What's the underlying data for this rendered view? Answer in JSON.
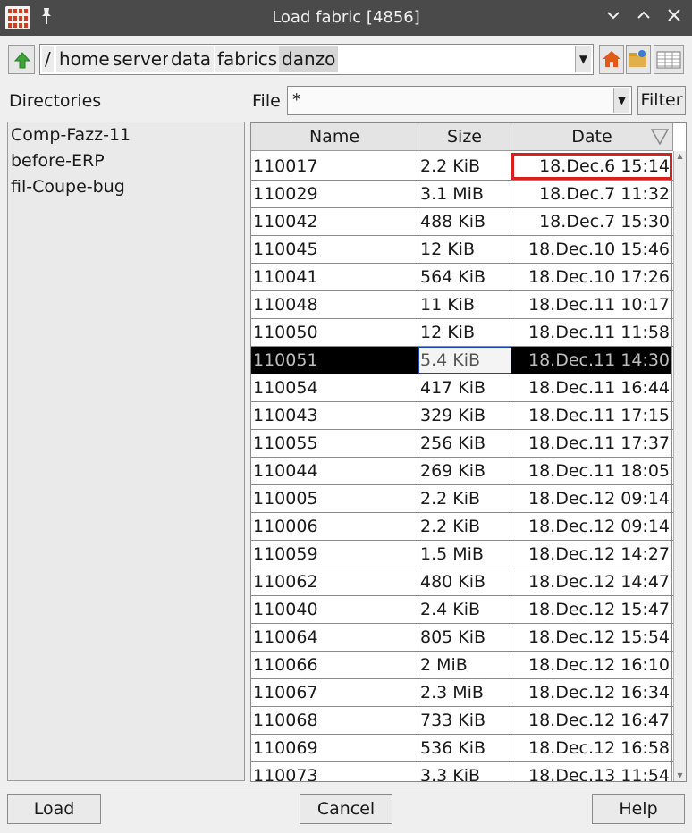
{
  "window": {
    "title": "Load fabric [4856]",
    "icons": [
      "app-icon",
      "pin-icon",
      "minimize-icon",
      "maximize-icon",
      "close-icon"
    ]
  },
  "path": {
    "root": "/",
    "segments": [
      "home",
      "server",
      "data",
      "fabrics",
      "danzo"
    ],
    "toolbar_icons": [
      "up-arrow-icon",
      "home-icon",
      "new-folder-icon",
      "detail-view-icon"
    ]
  },
  "directories": {
    "label": "Directories",
    "items": [
      "Comp-Fazz-11",
      "before-ERP",
      "fil-Coupe-bug"
    ]
  },
  "filter": {
    "label": "File",
    "value": "*",
    "button_label": "Filter"
  },
  "table": {
    "columns": [
      "Name",
      "Size",
      "Date"
    ],
    "sort_column": "Date",
    "sort_icon": "sort-desc-icon",
    "rows": [
      {
        "name": "110017",
        "size": "2.2 KiB",
        "date": "18.Dec.6 15:14"
      },
      {
        "name": "110029",
        "size": "3.1 MiB",
        "date": "18.Dec.7 11:32"
      },
      {
        "name": "110042",
        "size": "488 KiB",
        "date": "18.Dec.7 15:30"
      },
      {
        "name": "110045",
        "size": "12 KiB",
        "date": "18.Dec.10 15:46"
      },
      {
        "name": "110041",
        "size": "564 KiB",
        "date": "18.Dec.10 17:26"
      },
      {
        "name": "110048",
        "size": "11 KiB",
        "date": "18.Dec.11 10:17"
      },
      {
        "name": "110050",
        "size": "12 KiB",
        "date": "18.Dec.11 11:58"
      },
      {
        "name": "110051",
        "size": "5.4 KiB",
        "date": "18.Dec.11 14:30"
      },
      {
        "name": "110054",
        "size": "417 KiB",
        "date": "18.Dec.11 16:44"
      },
      {
        "name": "110043",
        "size": "329 KiB",
        "date": "18.Dec.11 17:15"
      },
      {
        "name": "110055",
        "size": "256 KiB",
        "date": "18.Dec.11 17:37"
      },
      {
        "name": "110044",
        "size": "269 KiB",
        "date": "18.Dec.11 18:05"
      },
      {
        "name": "110005",
        "size": "2.2 KiB",
        "date": "18.Dec.12 09:14"
      },
      {
        "name": "110006",
        "size": "2.2 KiB",
        "date": "18.Dec.12 09:14"
      },
      {
        "name": "110059",
        "size": "1.5 MiB",
        "date": "18.Dec.12 14:27"
      },
      {
        "name": "110062",
        "size": "480 KiB",
        "date": "18.Dec.12 14:47"
      },
      {
        "name": "110040",
        "size": "2.4 KiB",
        "date": "18.Dec.12 15:47"
      },
      {
        "name": "110064",
        "size": "805 KiB",
        "date": "18.Dec.12 15:54"
      },
      {
        "name": "110066",
        "size": "2 MiB",
        "date": "18.Dec.12 16:10"
      },
      {
        "name": "110067",
        "size": "2.3 MiB",
        "date": "18.Dec.12 16:34"
      },
      {
        "name": "110068",
        "size": "733 KiB",
        "date": "18.Dec.12 16:47"
      },
      {
        "name": "110069",
        "size": "536 KiB",
        "date": "18.Dec.12 16:58"
      },
      {
        "name": "110073",
        "size": "3.3 KiB",
        "date": "18.Dec.13 11:54"
      }
    ],
    "selected_index": 7,
    "highlighted_index": 0,
    "highlight_color": "#d9201f",
    "selection_color": "#000000"
  },
  "buttons": {
    "load": "Load",
    "cancel": "Cancel",
    "help": "Help"
  },
  "colors": {
    "titlebar": "#4a4a4a",
    "up_arrow": "#3fa33a",
    "home_icon": "#e05a1a"
  }
}
